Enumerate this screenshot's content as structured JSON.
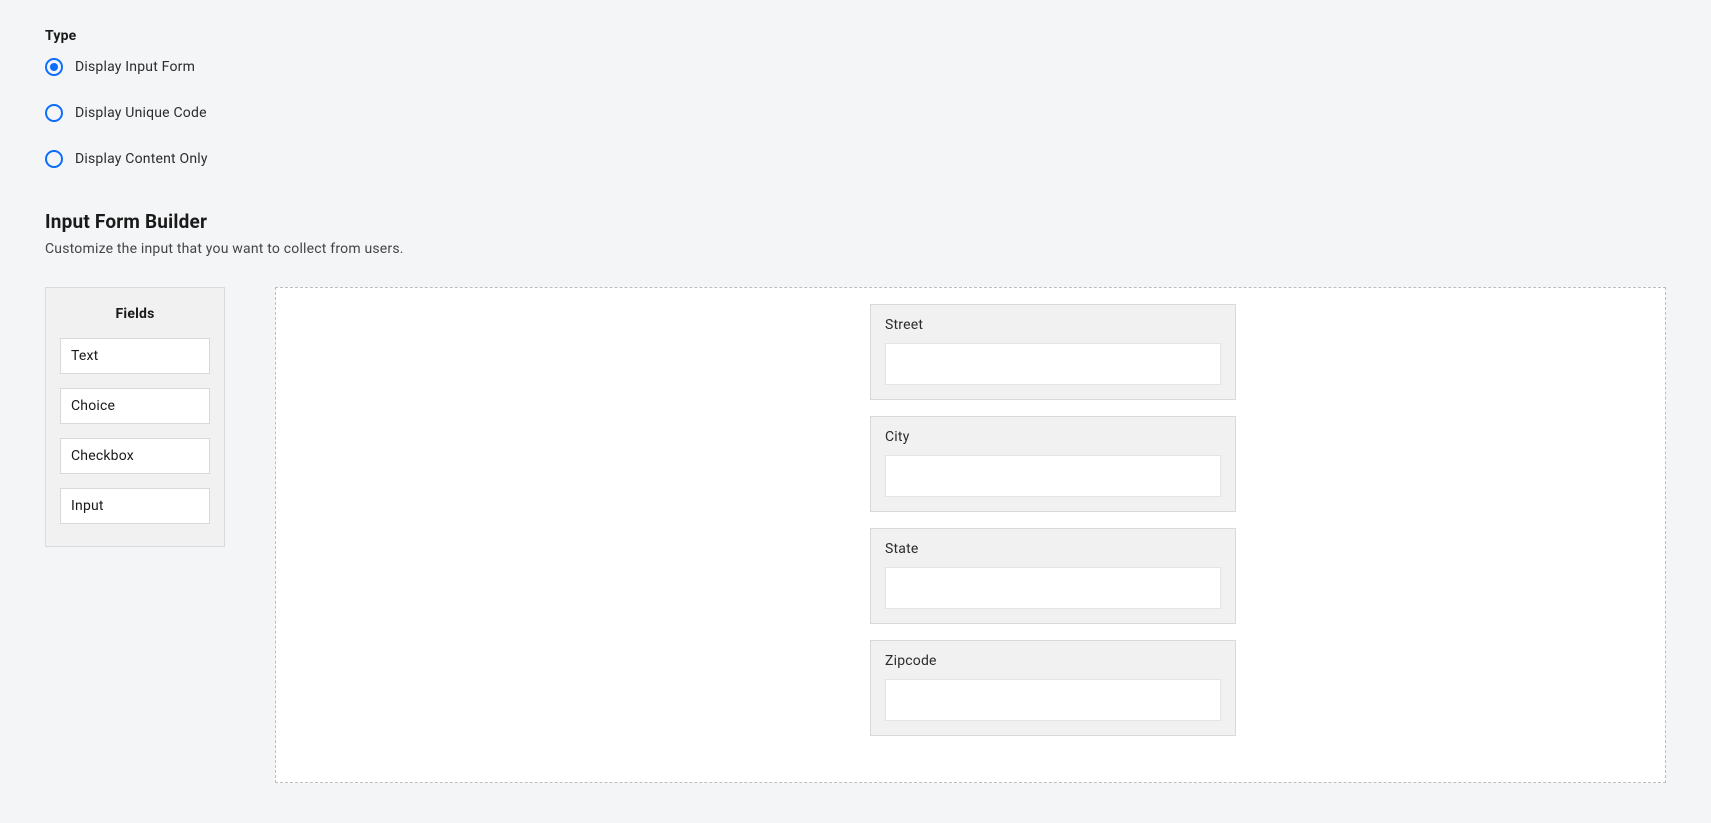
{
  "type_section": {
    "heading": "Type",
    "options": [
      {
        "label": "Display Input Form",
        "selected": true
      },
      {
        "label": "Display Unique Code",
        "selected": false
      },
      {
        "label": "Display Content Only",
        "selected": false
      }
    ]
  },
  "builder": {
    "heading": "Input Form Builder",
    "subheading": "Customize the input that you want to collect from users."
  },
  "fields_panel": {
    "title": "Fields",
    "items": [
      "Text",
      "Choice",
      "Checkbox",
      "Input"
    ]
  },
  "form_fields": [
    {
      "label": "Street",
      "value": ""
    },
    {
      "label": "City",
      "value": ""
    },
    {
      "label": "State",
      "value": ""
    },
    {
      "label": "Zipcode",
      "value": ""
    }
  ]
}
